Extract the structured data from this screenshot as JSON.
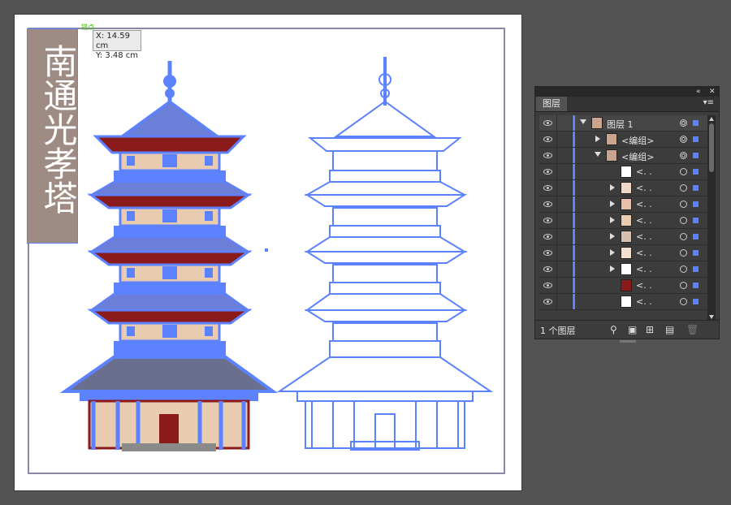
{
  "artboard": {
    "title_text": "南通光孝塔",
    "cursor_marker": "锚点",
    "coord_tooltip": {
      "x_text": "X: 14.59 cm",
      "y_text": "Y: 3.48 cm"
    }
  },
  "colors": {
    "selection": "#5d82ff",
    "roof_red": "#8b1a1a",
    "wall_beige": "#e9cbb0",
    "title_bg": "#9e8b83"
  },
  "layers_panel": {
    "tab_label": "图层",
    "menu_icon": "panel-menu-icon",
    "rows": [
      {
        "label": "图层 1",
        "indent": 0,
        "expanded": true,
        "selected": true,
        "target": "double"
      },
      {
        "label": "<编组>",
        "indent": 1,
        "expanded": false,
        "selected": false,
        "target": "double"
      },
      {
        "label": "<编组>",
        "indent": 1,
        "expanded": true,
        "selected": false,
        "target": "double"
      },
      {
        "label": "<. .",
        "indent": 2,
        "expanded": null,
        "selected": false,
        "target": "single"
      },
      {
        "label": "<. .",
        "indent": 2,
        "expanded": false,
        "selected": false,
        "target": "single"
      },
      {
        "label": "<. .",
        "indent": 2,
        "expanded": false,
        "selected": false,
        "target": "single"
      },
      {
        "label": "<. .",
        "indent": 2,
        "expanded": false,
        "selected": false,
        "target": "single"
      },
      {
        "label": "<. .",
        "indent": 2,
        "expanded": false,
        "selected": false,
        "target": "single"
      },
      {
        "label": "<. .",
        "indent": 2,
        "expanded": false,
        "selected": false,
        "target": "single"
      },
      {
        "label": "<. .",
        "indent": 2,
        "expanded": false,
        "selected": false,
        "target": "single"
      },
      {
        "label": "<. .",
        "indent": 2,
        "expanded": null,
        "selected": false,
        "target": "single"
      },
      {
        "label": "<. .",
        "indent": 2,
        "expanded": null,
        "selected": false,
        "target": "single"
      }
    ],
    "footer": {
      "count_label": "1 个图层",
      "icons": [
        "search-icon",
        "make-clipping-mask-icon",
        "create-sublayer-icon",
        "create-new-layer-icon",
        "delete-icon"
      ]
    }
  }
}
